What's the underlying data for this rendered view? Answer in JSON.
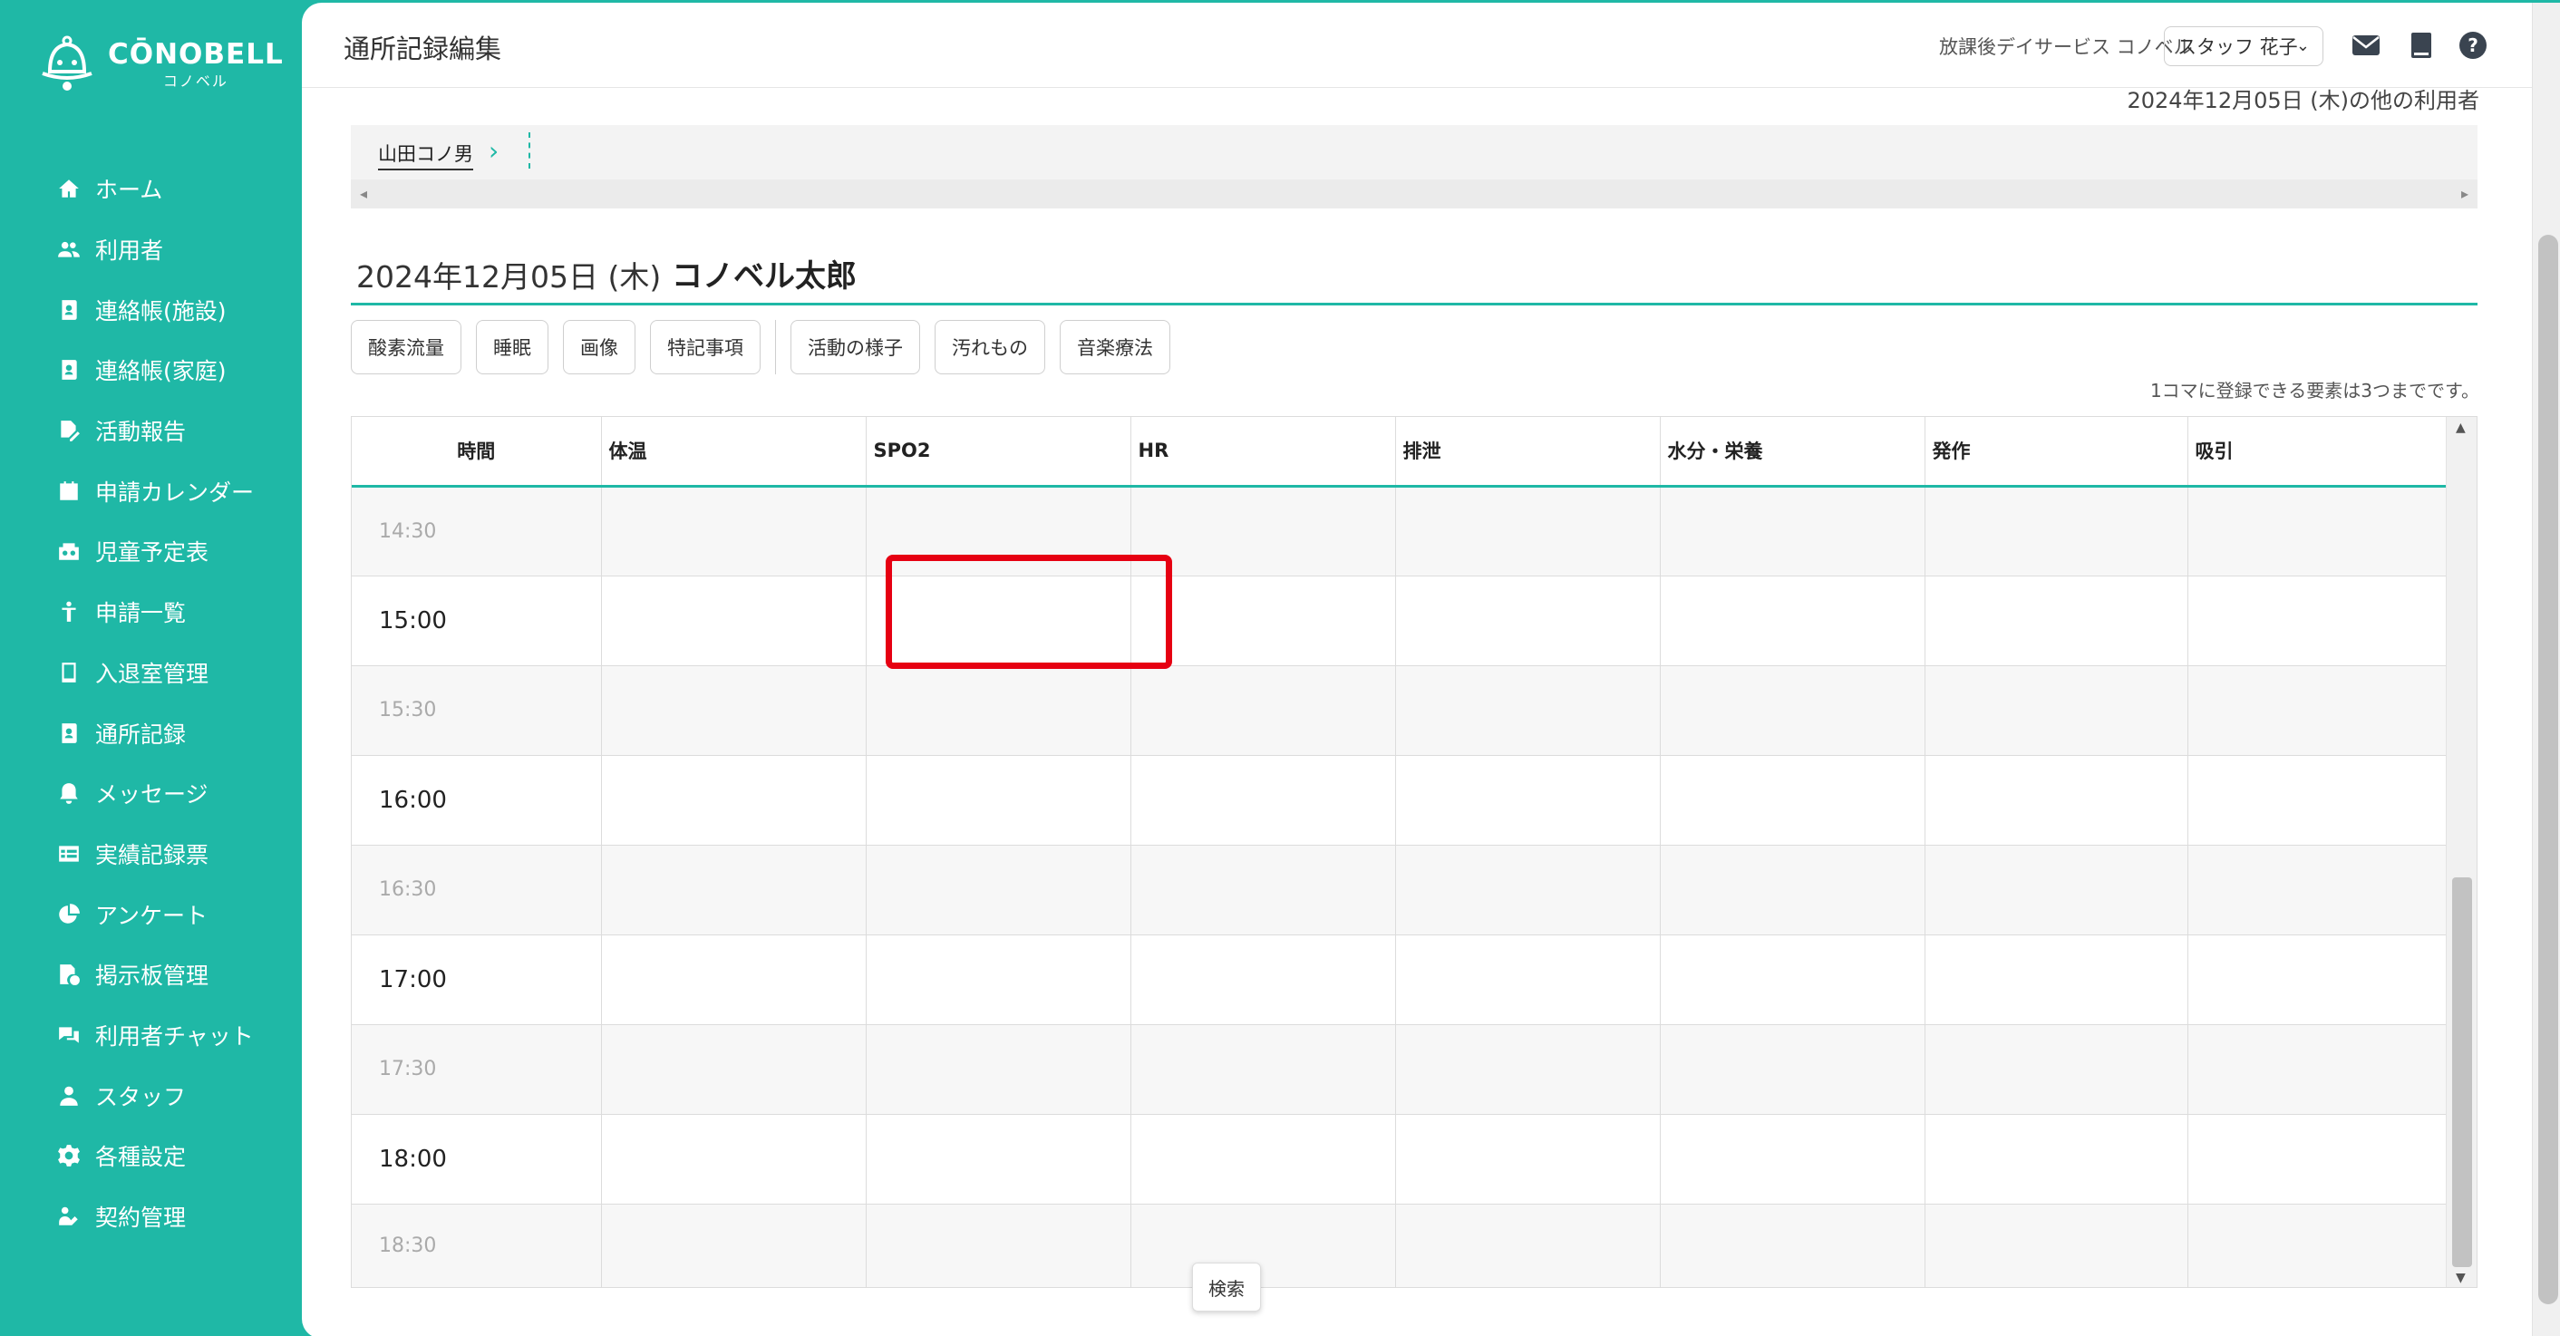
{
  "brand": {
    "name": "CŌNOBELL",
    "sub": "コノベル"
  },
  "nav": [
    {
      "label": "ホーム",
      "icon": "home-icon"
    },
    {
      "label": "利用者",
      "icon": "users-icon"
    },
    {
      "label": "連絡帳(施設)",
      "icon": "contact-book-icon"
    },
    {
      "label": "連絡帳(家庭)",
      "icon": "contact-book-icon"
    },
    {
      "label": "活動報告",
      "icon": "report-edit-icon"
    },
    {
      "label": "申請カレンダー",
      "icon": "calendar-icon"
    },
    {
      "label": "児童予定表",
      "icon": "schedule-icon"
    },
    {
      "label": "申請一覧",
      "icon": "person-icon"
    },
    {
      "label": "入退室管理",
      "icon": "tablet-icon"
    },
    {
      "label": "通所記録",
      "icon": "record-icon"
    },
    {
      "label": "メッセージ",
      "icon": "bell-icon"
    },
    {
      "label": "実績記録票",
      "icon": "table-icon"
    },
    {
      "label": "アンケート",
      "icon": "pie-chart-icon"
    },
    {
      "label": "掲示板管理",
      "icon": "board-icon"
    },
    {
      "label": "利用者チャット",
      "icon": "chat-icon"
    },
    {
      "label": "スタッフ",
      "icon": "staff-icon"
    },
    {
      "label": "各種設定",
      "icon": "gear-icon"
    },
    {
      "label": "契約管理",
      "icon": "contract-icon"
    }
  ],
  "header": {
    "title": "通所記録編集",
    "facility": "放課後デイサービス コノベル",
    "staff": "スタッフ 花子"
  },
  "other_users": "2024年12月05日 (木)の他の利用者",
  "user_tab": "山田コノ男",
  "record": {
    "date": "2024年12月05日 (木)",
    "name": "コノベル太郎"
  },
  "chips_group1": [
    "酸素流量",
    "睡眠",
    "画像",
    "特記事項"
  ],
  "chips_group2": [
    "活動の様子",
    "汚れもの",
    "音楽療法"
  ],
  "limit_note": "1コマに登録できる要素は3つまでです。",
  "grid": {
    "headers": [
      "時間",
      "体温",
      "SPO2",
      "HR",
      "排泄",
      "水分・栄養",
      "発作",
      "吸引"
    ],
    "times": [
      "14:30",
      "15:00",
      "15:30",
      "16:00",
      "16:30",
      "17:00",
      "17:30",
      "18:00",
      "18:30"
    ]
  },
  "search_label": "検索",
  "colors": {
    "accent": "#1fb8a6",
    "highlight": "#e60012"
  }
}
